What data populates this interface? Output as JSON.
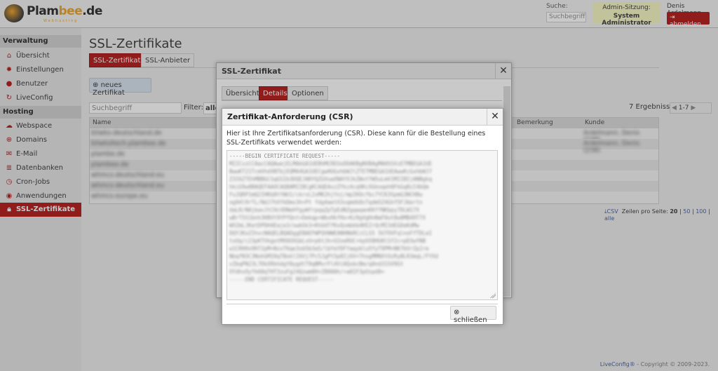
{
  "header": {
    "logo_text": "Plambee.de",
    "logo_sub": "Webhosting",
    "search_label": "Suche:",
    "search_placeholder": "Suchbegriff",
    "admin_label": "Admin-Sitzung:",
    "admin_role": "System Administrator",
    "user_name": "Denis Ardelmann",
    "logout_label": "abmelden"
  },
  "sidebar": {
    "groups": [
      {
        "label": "Verwaltung",
        "items": [
          {
            "label": "Übersicht",
            "icon": "home-icon"
          },
          {
            "label": "Einstellungen",
            "icon": "gear-icon"
          },
          {
            "label": "Benutzer",
            "icon": "user-icon"
          },
          {
            "label": "LiveConfig",
            "icon": "liveconfig-icon"
          }
        ]
      },
      {
        "label": "Hosting",
        "items": [
          {
            "label": "Webspace",
            "icon": "cloud-icon"
          },
          {
            "label": "Domains",
            "icon": "globe-icon"
          },
          {
            "label": "E-Mail",
            "icon": "mail-icon"
          },
          {
            "label": "Datenbanken",
            "icon": "database-icon"
          },
          {
            "label": "Cron-Jobs",
            "icon": "clock-icon"
          },
          {
            "label": "Anwendungen",
            "icon": "apps-icon"
          },
          {
            "label": "SSL-Zertifikate",
            "icon": "lock-icon",
            "active": true
          }
        ]
      }
    ]
  },
  "main": {
    "title": "SSL-Zertifikate",
    "tabs": [
      "SSL-Zertifikate",
      "SSL-Anbieter"
    ],
    "new_button": "neues Zertifikat",
    "search_placeholder": "Suchbegriff",
    "filter_label": "Filter:",
    "filter_value": "alle",
    "results": "7 Ergebnisse",
    "page_select": "1-7",
    "columns": [
      "Name",
      "Bemerkung",
      "Kunde"
    ],
    "rows": [
      {
        "name": "bliwks-deutschland.de",
        "kunde": "Ardelmann, Denis (238)"
      },
      {
        "name": "bliwksltech.plambee.de",
        "kunde": "Ardelmann, Denis (238)"
      },
      {
        "name": "plambe.de",
        "kunde": ""
      },
      {
        "name": "plambee.de",
        "kunde": ""
      },
      {
        "name": "whmcs-deutschland.eu",
        "kunde": ""
      },
      {
        "name": "whmcs-deutschland.eu",
        "kunde": ""
      },
      {
        "name": "whmcs-europe.eu",
        "kunde": ""
      }
    ],
    "csv_label": "CSV",
    "rows_per_page_label": "Zeilen pro Seite:",
    "rows_per_page_options": [
      "20",
      "50",
      "100",
      "alle"
    ]
  },
  "dialog_outer": {
    "title": "SSL-Zertifikat",
    "tabs": [
      "Übersicht",
      "Details",
      "Optionen"
    ],
    "active_tab": "Details"
  },
  "dialog_csr": {
    "title": "Zertifikat-Anforderung (CSR)",
    "intro": "Hier ist Ihre Zertifikatsanforderung (CSR). Diese kann für die Bestellung eines SSL-Zertifikats verwendet werden:",
    "csr_begin": "-----BEGIN CERTIFICATE REQUEST-----",
    "csr_body": "MIICvzCCAacCAQAwejELMAkGA1UEBhMCREUxDDAKBgNVBAgMA0SSVzETMBEGA1UE\nBwwKT21TcmVhdXNTbjEQMA4GA1UECgwHUGxhbWJlZTETMBEGA1UEAwwKcGxhbWJ7\nZ3I6ZTEhMBBGCSqGSIb3DQEJARYQZGVuaXNAYXJkZWxtYW5uLmV1MIIBIjANBgkq\nhkiG9w0BAQEFAAOCAQ8AMIIBCgKCAQEAvzZYkz4cq9KcXGkoqeh0FkGq8zI4bQm\nFuJQRP1mQ2IHKb8tYWU1/ckrvL2vMK2hjYoj/mpIKOcfbc7YCK3SpmG3NCH8w\nog94l9rTL/NdJ7hXfkDmx3h+Pt fdg4aetX3sqmdk8sTqdm5Z4Ghf5FJ6ertn\ndaLR/N0jbavJtCHcVDNeHfgyWfrpqqZpTpEdNZgqaqanKKffNKbpy7DLW17X\nwBrT5S1bnh3H8Vt9YPfQnt+Dekqp+WbxHkfHx+Kz9gVgHnNaF0ut8w8MB49T7X\nWXZmLJKetDPDH4Eaje3/owbSk3+KhUdTfKvQsmbkb4KEZrQcMI3dEGDeKdMw\nDQYJKoZIhvcNAQELBQADggEBAEFWPQVWWEANHNbRCcCLS5 5U7OVFqlnoFfTDLeI\ntxUq/c23pKTVkgotMX6OXGbLvU+p6tJh+U2oeRUC+kpXX8HU0lSf2c+pD3wYNB\nw1CRHHx9H72pM+NzxT6qe3sb5b3a5/lbYeYDFYaqyblu5YyT9PM+NK7bVrZp2re\nNbqfN3C3NohGMI0qTBoklI6Vj7Pc5JgPt5p8Ij6V+ThxgMMNXtOzRyBLR3mqL/FYXd\nvZbqPN23L7DkXRkhdgY8ygdtT9qBMvrFl4Vi0QsbcBm/q0nd31SV9Gt\nOYdhsOyfk60qTHT3zuFg24Qzwm0H+Z8000h/+a0IF3pUspd0=",
    "csr_end": "-----END CERTIFICATE REQUEST-----",
    "close_label": "schließen"
  },
  "footer": {
    "brand": "LiveConfig®",
    "copyright": " - Copyright © 2009-2023."
  },
  "colors": {
    "accent": "#b01010",
    "admin_badge": "#f5f5c0",
    "link": "#3a5aa0"
  }
}
